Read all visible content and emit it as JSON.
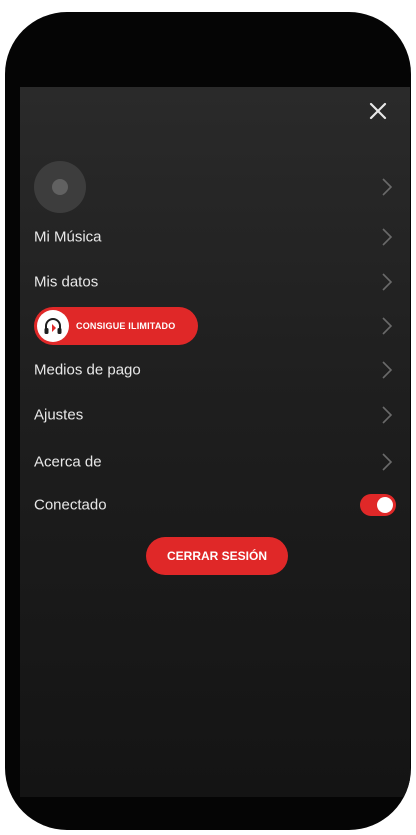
{
  "colors": {
    "accent": "#e02828",
    "background": "#1e1e1e",
    "text": "#e8e8e8",
    "chevron": "#6a6a6a"
  },
  "header": {
    "close_icon": "close-icon"
  },
  "profile": {
    "avatar_icon": "user-icon",
    "chevron_icon": "chevron-right-icon"
  },
  "menu": {
    "items": [
      {
        "label": "Mi Música"
      },
      {
        "label": "Mis datos"
      },
      {
        "label": "Medios de pago"
      },
      {
        "label": "Ajustes"
      },
      {
        "label": "Acerca de"
      }
    ]
  },
  "promo": {
    "label": "CONSIGUE ILIMITADO",
    "icon": "headphones-icon"
  },
  "connected": {
    "label": "Conectado",
    "enabled": true
  },
  "logout": {
    "label": "CERRAR SESIÓN"
  }
}
